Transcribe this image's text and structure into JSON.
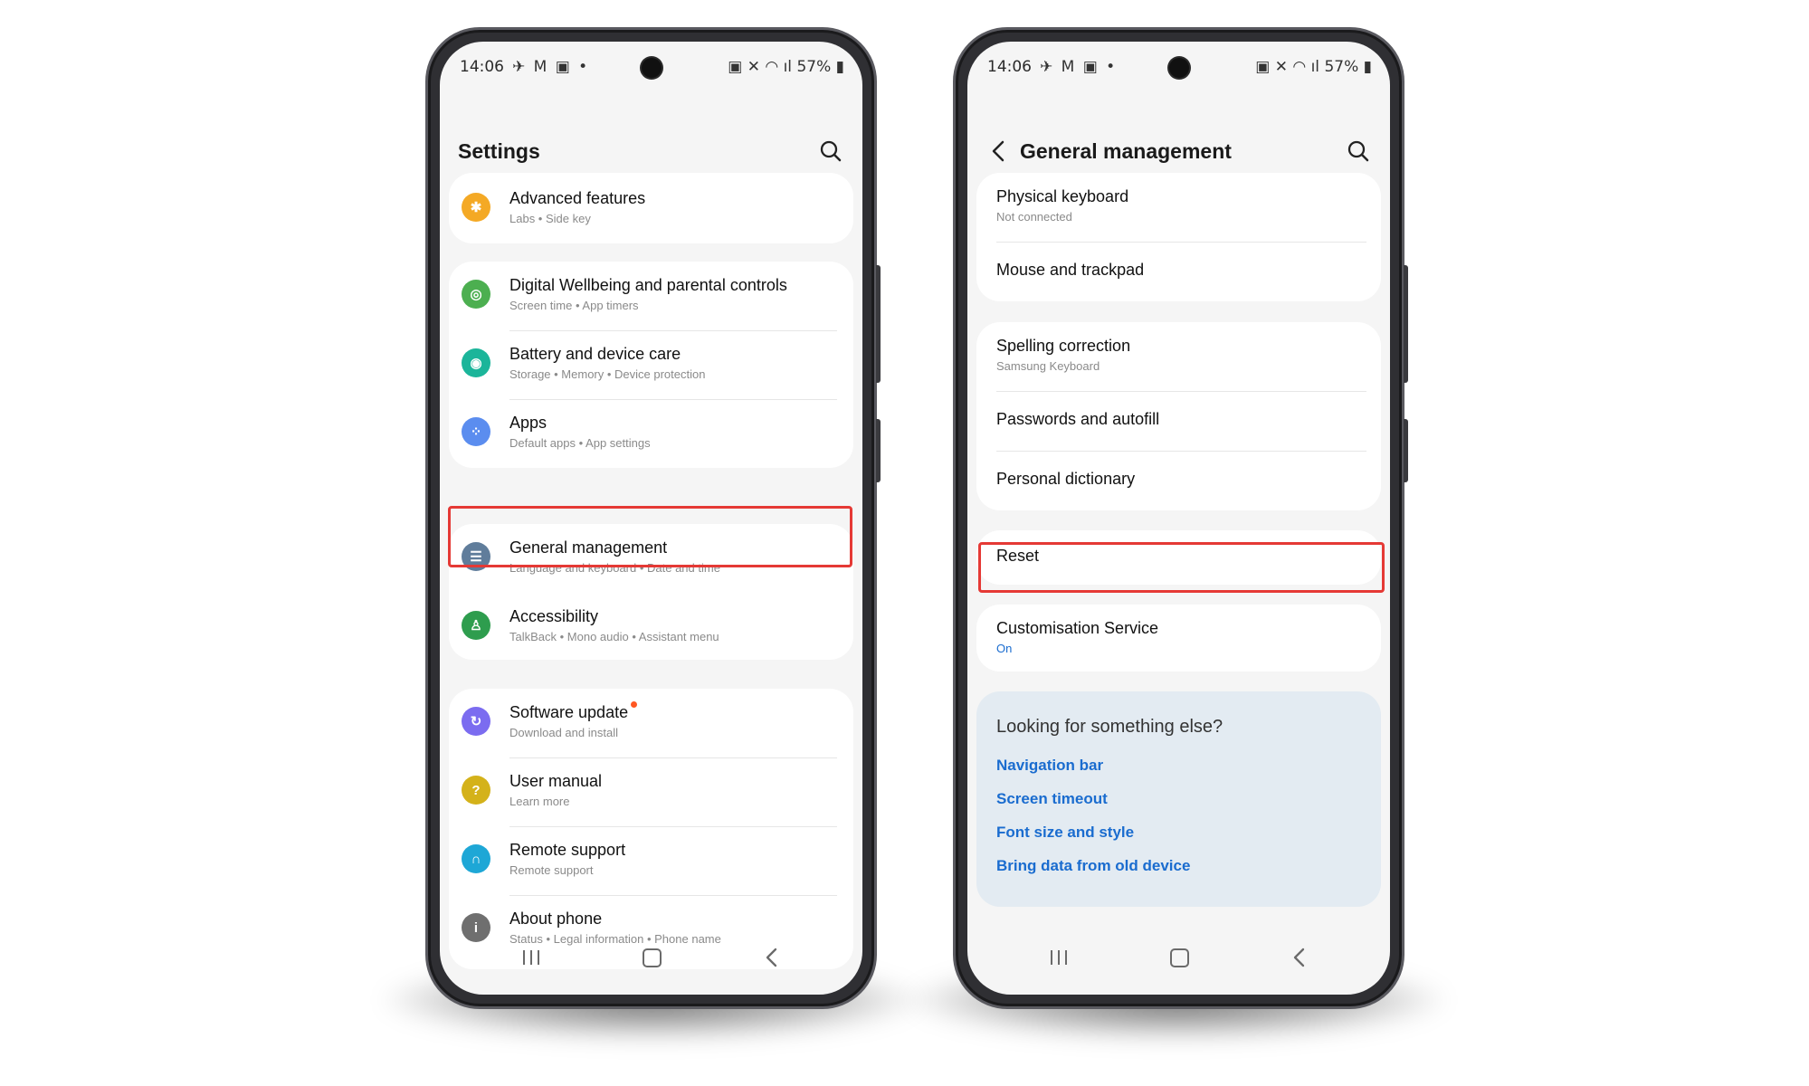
{
  "status_bar": {
    "time": "14:06",
    "left_icons": "✈ M ▣ •",
    "right_text": "57%"
  },
  "left_screen": {
    "title": "Settings",
    "items": [
      {
        "label": "Advanced features",
        "sub": "Labs • Side key",
        "icon": "gear-icon",
        "color": "#f4a925"
      },
      {
        "label": "Digital Wellbeing and parental controls",
        "sub": "Screen time • App timers",
        "icon": "wellbeing-icon",
        "color": "#4caf50"
      },
      {
        "label": "Battery and device care",
        "sub": "Storage • Memory • Device protection",
        "icon": "device-care-icon",
        "color": "#1bb59a"
      },
      {
        "label": "Apps",
        "sub": "Default apps • App settings",
        "icon": "apps-icon",
        "color": "#5b8def"
      },
      {
        "label": "General management",
        "sub": "Language and keyboard • Date and time",
        "icon": "sliders-icon",
        "color": "#607d9b"
      },
      {
        "label": "Accessibility",
        "sub": "TalkBack • Mono audio • Assistant menu",
        "icon": "accessibility-icon",
        "color": "#2e9d4e"
      },
      {
        "label": "Software update",
        "sub": "Download and install",
        "icon": "update-icon",
        "color": "#7b6cf0"
      },
      {
        "label": "User manual",
        "sub": "Learn more",
        "icon": "manual-icon",
        "color": "#d4b21a"
      },
      {
        "label": "Remote support",
        "sub": "Remote support",
        "icon": "headset-icon",
        "color": "#1ea7d6"
      },
      {
        "label": "About phone",
        "sub": "Status • Legal information • Phone name",
        "icon": "info-icon",
        "color": "#6f6f6f"
      }
    ]
  },
  "right_screen": {
    "title": "General management",
    "items": [
      {
        "label": "Physical keyboard",
        "sub": "Not connected"
      },
      {
        "label": "Mouse and trackpad",
        "sub": ""
      },
      {
        "label": "Spelling correction",
        "sub": "Samsung Keyboard"
      },
      {
        "label": "Passwords and autofill",
        "sub": ""
      },
      {
        "label": "Personal dictionary",
        "sub": ""
      },
      {
        "label": "Reset",
        "sub": ""
      },
      {
        "label": "Customisation Service",
        "sub": "On"
      }
    ],
    "suggestions": {
      "heading": "Looking for something else?",
      "links": [
        "Navigation bar",
        "Screen timeout",
        "Font size and style",
        "Bring data from old device"
      ]
    }
  },
  "colors": {
    "highlight": "#e53935",
    "link": "#1a6ccf",
    "on_status": "#1a6ccf",
    "badge": "#ff5722"
  }
}
